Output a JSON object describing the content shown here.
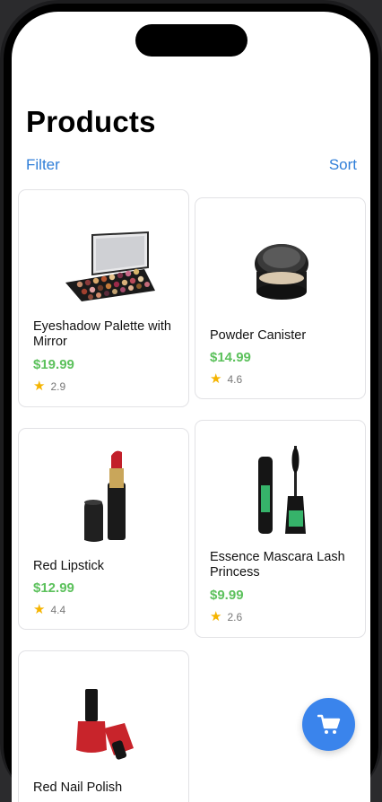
{
  "header": {
    "title": "Products",
    "filter_label": "Filter",
    "sort_label": "Sort"
  },
  "products": [
    {
      "name": "Eyeshadow Palette with Mirror",
      "price": "$19.99",
      "rating": "2.9",
      "image_icon": "eyeshadow-palette-icon"
    },
    {
      "name": "Powder Canister",
      "price": "$14.99",
      "rating": "4.6",
      "image_icon": "powder-canister-icon"
    },
    {
      "name": "Red Lipstick",
      "price": "$12.99",
      "rating": "4.4",
      "image_icon": "lipstick-icon"
    },
    {
      "name": "Essence Mascara Lash Princess",
      "price": "$9.99",
      "rating": "2.6",
      "image_icon": "mascara-icon"
    },
    {
      "name": "Red Nail Polish",
      "price": "",
      "rating": "",
      "image_icon": "nail-polish-icon"
    }
  ],
  "cart_button": {
    "icon": "cart-icon"
  },
  "colors": {
    "accent": "#2f7ed8",
    "price": "#5cc15c",
    "star": "#f5b400",
    "fab": "#3a84ec"
  }
}
